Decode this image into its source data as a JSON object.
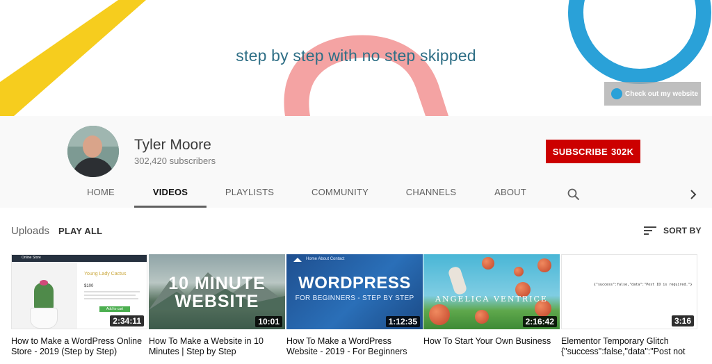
{
  "banner": {
    "tagline": "step by step with no step skipped",
    "link_label": "Check out my website",
    "colors": {
      "yellow": "#f6cd1e",
      "pink": "#f4a3a3",
      "blue": "#2aa1d8"
    }
  },
  "channel": {
    "name": "Tyler Moore",
    "subscribers": "302,420 subscribers",
    "subscribe_label": "SUBSCRIBE",
    "subscribe_count": "302K"
  },
  "tabs": [
    {
      "label": "HOME",
      "active": false
    },
    {
      "label": "VIDEOS",
      "active": true
    },
    {
      "label": "PLAYLISTS",
      "active": false
    },
    {
      "label": "COMMUNITY",
      "active": false
    },
    {
      "label": "CHANNELS",
      "active": false
    },
    {
      "label": "ABOUT",
      "active": false
    }
  ],
  "uploads": {
    "title": "Uploads",
    "play_all": "PLAY ALL",
    "sort_label": "SORT BY"
  },
  "videos": [
    {
      "title": "How to Make a WordPress Online Store - 2019 (Step by Step)",
      "duration": "2:34:11",
      "thumb_text": {
        "bar": "Online Store",
        "product": "Young Lady Cactus",
        "price": "$100",
        "cart": "Add to cart"
      }
    },
    {
      "title": "How To Make a Website in 10 Minutes | Step by Step",
      "duration": "10:01",
      "thumb_text": {
        "line1": "10 MINUTE",
        "line2": "WEBSITE"
      }
    },
    {
      "title": "How To Make a WordPress Website - 2019 - For Beginners",
      "duration": "1:12:35",
      "thumb_text": {
        "nav": "Home   About   Contact",
        "big": "WORDPRESS",
        "sub": "FOR BEGINNERS - STEP BY STEP"
      }
    },
    {
      "title": "How To Start Your Own Business",
      "duration": "2:16:42",
      "thumb_text": {
        "name": "ANGELICA VENTRICE"
      }
    },
    {
      "title": "Elementor Temporary Glitch {\"success\":false,\"data\":\"Post not found\"}",
      "duration": "3:16",
      "thumb_text": {
        "code": "{\"success\":false,\"data\":\"Post ID is required.\"}"
      }
    }
  ]
}
